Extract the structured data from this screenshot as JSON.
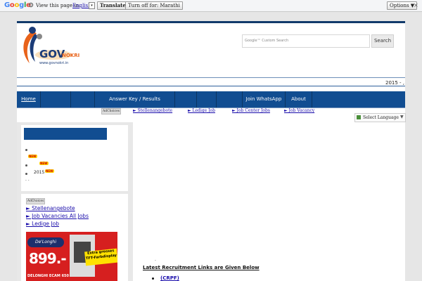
{
  "translate_bar": {
    "google_label": "Google",
    "view_label": "View this page in:",
    "language": "English",
    "translate_button": "Translate",
    "turn_off_button": "Turn off for: Marathi",
    "options_button": "Options ▼",
    "close": "×"
  },
  "header": {
    "logo_gov": "GOV",
    "logo_nokri": "NOKRI",
    "logo_url": "www.govnokri.in",
    "search_placeholder": "Google™ Custom Search",
    "search_button": "Search",
    "ticker": "2015 -  ,"
  },
  "nav": {
    "items": [
      {
        "label": "Home",
        "width": 34
      },
      {
        "label": "",
        "width": 43
      },
      {
        "label": "",
        "width": 34
      },
      {
        "label": "Answer Key / Results",
        "width": 114
      },
      {
        "label": "",
        "width": 31
      },
      {
        "label": "",
        "width": 28
      },
      {
        "label": "",
        "width": 37
      },
      {
        "label": "Join WhatsApp",
        "width": 61
      },
      {
        "label": "About",
        "width": 38
      }
    ]
  },
  "top_ads": {
    "adchoices": "AdChoices",
    "links": [
      "► Stellenangebote",
      "► Ledige Job",
      "► Job Center Jobs",
      "► Job Vacancy"
    ]
  },
  "select_language": "Select Language",
  "sidebar_list": {
    "new_badge": "NEW",
    "year": "2015",
    "trailing": ".  ."
  },
  "side_ads": {
    "adchoices": "AdChoices",
    "links": [
      "► Stellenangebote",
      "► Job Vacancies All Jobs",
      "► Ledige Job"
    ],
    "banner_brand": "De'Longhi",
    "banner_price": "899.-",
    "banner_tag": "Extra grosses TFT-Farbdisplay",
    "banner_caption": "DELONGHI ECAM 650"
  },
  "main": {
    "dot": ".",
    "latest_heading": "Latest Recruitment Links are Given Below",
    "first_link": "(CRPF)"
  },
  "colors": {
    "nav_blue": "#114d91",
    "logo_orange": "#e8621a",
    "logo_navy": "#1b3c78"
  }
}
